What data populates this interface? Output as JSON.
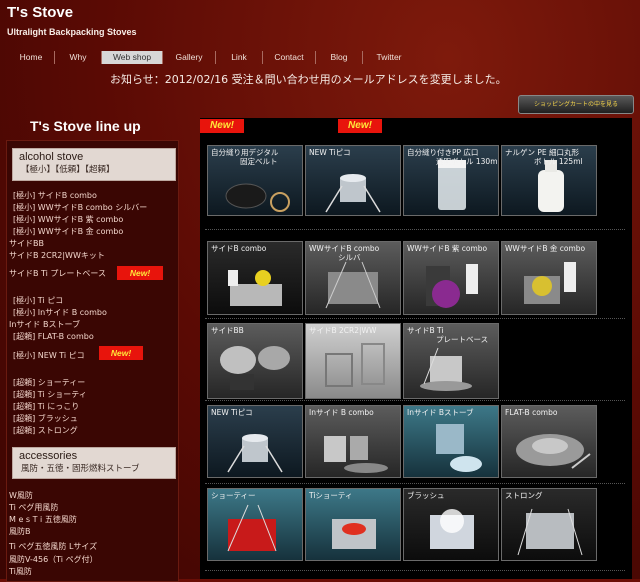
{
  "site": {
    "title": "T's Stove",
    "subtitle": "Ultralight Backpacking Stoves"
  },
  "nav": [
    {
      "label": "Home",
      "active": false
    },
    {
      "label": "Why",
      "active": false
    },
    {
      "label": "Web shop",
      "active": true
    },
    {
      "label": "Gallery",
      "active": false
    },
    {
      "label": "Link",
      "active": false
    },
    {
      "label": "Contact",
      "active": false
    },
    {
      "label": "Blog",
      "active": false
    },
    {
      "label": "Twitter",
      "active": false
    }
  ],
  "notice": "お知らせ：2012/02/16 受注＆問い合わせ用のメールアドレスを変更しました。",
  "cart_button": "ショッピングカートの中を見る",
  "sidebar": {
    "title": "T's Stove line up",
    "alcohol": {
      "title": "alcohol stove",
      "subtitle": "【極小】【低頼】【超頼】"
    },
    "links": [
      "[極小] サイドB combo",
      "[極小] WWサイドB combo シルバー",
      "[極小] WWサイドB 紫 combo",
      "[極小] WWサイドB 金 combo",
      "サイドBB",
      "サイドB 2CR2|WWキット",
      "サイドB Ti プレートベース",
      "[極小] Ti ピコ",
      "[極小] Inサイド B combo",
      "Inサイド Bストーブ",
      "[超頼] FLAT-B combo",
      "[極小] NEW Ti ピコ",
      "[超頼] ショーティー",
      "[超頼] Ti ショーティ",
      "[超頼] Ti にっこり",
      "[超頼] ブラッシュ",
      "[超頼] ストロング"
    ],
    "accessories": {
      "title": "accessories",
      "subtitle": "風防・五徳・固形燃料ストーブ"
    },
    "acc_links": [
      "W風防",
      "Ti ペグ用風防",
      "M e s T i 五徳風防",
      "風防B",
      "Ti ペグ五徳風防 Lサイズ",
      "風防V-456（Ti ペグ付）",
      "Ti風防"
    ],
    "new_badge": "New!"
  },
  "main": {
    "new_badges": [
      "New!",
      "New!"
    ],
    "rows": [
      [
        {
          "cap": "自分縫り用デジタル",
          "cap2": "固定ベルト",
          "icon": "bag-scale-icon",
          "bg": "g-blue"
        },
        {
          "cap": "NEW Tiピコ",
          "cap2": "",
          "icon": "pico-stove-icon",
          "bg": "g-blue"
        },
        {
          "cap": "自分縫り付きPP 広口",
          "cap2": "透明ボトル 130ml",
          "icon": "clear-bottle-icon",
          "bg": "g-blue"
        },
        {
          "cap": "ナルゲン PE 細口丸形",
          "cap2": "ボトル 125ml",
          "icon": "white-bottle-icon",
          "bg": "g-blue"
        }
      ],
      [
        {
          "cap": "サイドB combo",
          "cap2": "",
          "icon": "stove-combo-icon",
          "bg": "g-dark"
        },
        {
          "cap": "WWサイドB combo",
          "cap2": "シルバ",
          "icon": "windscreen-icon",
          "bg": "g-gray"
        },
        {
          "cap": "WWサイドB 紫 combo",
          "cap2": "",
          "icon": "purple-stove-icon",
          "bg": "g-gray"
        },
        {
          "cap": "WWサイドB 金 combo",
          "cap2": "",
          "icon": "gold-stove-icon",
          "bg": "g-gray"
        }
      ],
      [
        {
          "cap": "サイドBB",
          "cap2": "",
          "icon": "disc-stove-icon",
          "bg": "g-gray"
        },
        {
          "cap": "サイドB 2CR2|WW",
          "cap2": "",
          "icon": "spring-stove-icon",
          "bg": "g-light"
        },
        {
          "cap": "サイドB Ti",
          "cap2": "プレートベース",
          "icon": "plate-stove-icon",
          "bg": "g-gray"
        }
      ],
      [
        {
          "cap": "NEW Tiピコ",
          "cap2": "",
          "icon": "pico-stove-icon",
          "bg": "g-blue"
        },
        {
          "cap": "Inサイド B combo",
          "cap2": "",
          "icon": "inside-combo-icon",
          "bg": "g-gray"
        },
        {
          "cap": "Inサイド Bストーブ",
          "cap2": "",
          "icon": "inside-stove-icon",
          "bg": "g-teal"
        },
        {
          "cap": "FLAT-B combo",
          "cap2": "",
          "icon": "flat-stove-icon",
          "bg": "g-gray"
        }
      ],
      [
        {
          "cap": "ショーティー",
          "cap2": "",
          "icon": "red-can-stove-icon",
          "bg": "g-teal"
        },
        {
          "cap": "Tiショーティ",
          "cap2": "",
          "icon": "ti-shorty-icon",
          "bg": "g-teal"
        },
        {
          "cap": "ブラッシュ",
          "cap2": "",
          "icon": "brush-stove-icon",
          "bg": "g-dark"
        },
        {
          "cap": "ストロング",
          "cap2": "",
          "icon": "strong-stove-icon",
          "bg": "g-dark"
        }
      ]
    ]
  }
}
